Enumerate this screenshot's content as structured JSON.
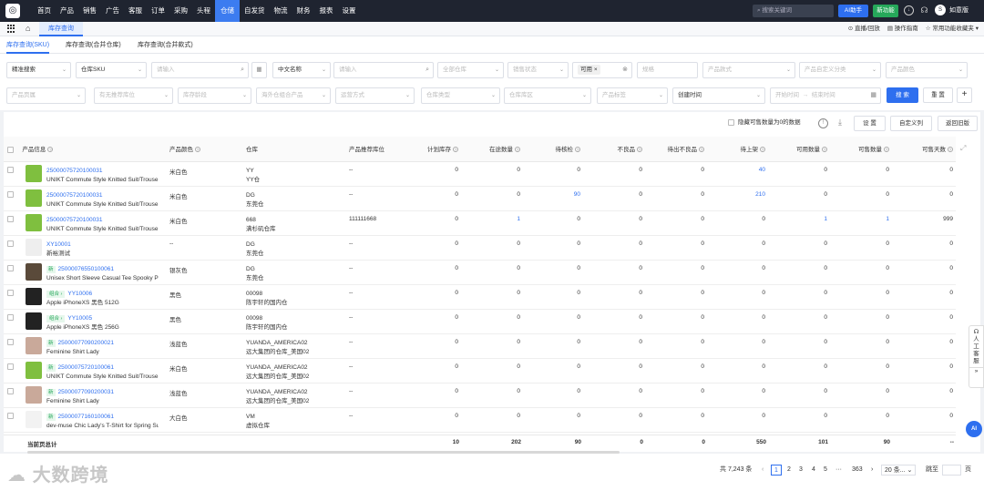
{
  "topnav": {
    "items": [
      "首页",
      "产品",
      "销售",
      "广告",
      "客服",
      "订单",
      "采购",
      "头程",
      "仓储",
      "自发货",
      "物流",
      "财务",
      "报表",
      "设置"
    ],
    "active": "仓储",
    "search_placeholder": "搜索关键词",
    "ai_label": "AI助手",
    "new_label": "新功能",
    "username": "如意版"
  },
  "tabbar": {
    "page_tab": "库存查询",
    "right_items": [
      "直播/回放",
      "操作指南",
      "常用功能收藏夹"
    ]
  },
  "subtabs": [
    "库存查询(SKU)",
    "库存查询(合并仓库)",
    "库存查询(合并款式)"
  ],
  "filters": {
    "row1": {
      "search_mode": "精准搜索",
      "sku_type": "仓库SKU",
      "input1_placeholder": "请输入",
      "name_type": "中文名称",
      "input2_placeholder": "请输入",
      "warehouse": "全部仓库",
      "sale_status": "销售状态",
      "available_tag": "可用",
      "spec": "规格",
      "product_style": "产品款式",
      "custom_category": "产品自定义分类",
      "product_color": "产品颜色"
    },
    "row2": {
      "product_attr": "产品页属",
      "replenish": "有无推荐库位",
      "inventory_age": "库存龄段",
      "overseas_platform": "海外仓组合产品",
      "shipping_method": "运营方式",
      "warehouse_type": "仓库类型",
      "warehouse_area": "仓库库区",
      "product_label": "产品标签",
      "time_type": "创建时间",
      "start_time": "开始时间",
      "end_time": "结束时间",
      "search_btn": "搜 索",
      "reset_btn": "重 置"
    }
  },
  "toolbar": {
    "hide_zero": "隐藏可售数量为0的数据",
    "settings": "设 置",
    "custom_columns": "自定义列",
    "back_old": "返回旧版"
  },
  "table": {
    "headers": [
      "产品信息",
      "产品颜色",
      "仓库",
      "产品推荐库位",
      "计划库存",
      "在途数量",
      "待核检",
      "不良品",
      "待出不良品",
      "待上架",
      "可用数量",
      "可售数量",
      "可售天数"
    ],
    "rows": [
      {
        "code": "25000075720100031",
        "name": "UNIKT Commute Style Knitted Suit/Trouse",
        "tag": "",
        "color": "米白色",
        "wh": "YY",
        "wh2": "YY仓",
        "loc": "--",
        "plan": "0",
        "transit": "0",
        "inspect": "0",
        "bad": "0",
        "badout": "0",
        "shelf": "40",
        "avail": "0",
        "sell": "0",
        "days": "0",
        "thumb": "#7fbf3f"
      },
      {
        "code": "25000075720100031",
        "name": "UNIKT Commute Style Knitted Suit/Trouse",
        "tag": "",
        "color": "米白色",
        "wh": "DG",
        "wh2": "东莞仓",
        "loc": "--",
        "plan": "0",
        "transit": "0",
        "inspect": "90",
        "bad": "0",
        "badout": "0",
        "shelf": "210",
        "avail": "0",
        "sell": "0",
        "days": "0",
        "thumb": "#7fbf3f"
      },
      {
        "code": "25000075720100031",
        "name": "UNIKT Commute Style Knitted Suit/Trouse",
        "tag": "",
        "color": "米白色",
        "wh": "668",
        "wh2": "满杉矶仓库",
        "loc": "111111668",
        "plan": "0",
        "transit": "1",
        "inspect": "0",
        "bad": "0",
        "badout": "0",
        "shelf": "0",
        "avail": "1",
        "sell": "1",
        "days": "999",
        "thumb": "#7fbf3f"
      },
      {
        "code": "XY10001",
        "name": "新裕测试",
        "tag": "",
        "color": "--",
        "wh": "DG",
        "wh2": "东莞仓",
        "loc": "--",
        "plan": "0",
        "transit": "0",
        "inspect": "0",
        "bad": "0",
        "badout": "0",
        "shelf": "0",
        "avail": "0",
        "sell": "0",
        "days": "0",
        "thumb": "#eeeeee"
      },
      {
        "code": "25000076550100061",
        "name": "Unisex Short Sleeve Casual Tee Spooky Pu",
        "tag": "新",
        "color": "银灰色",
        "wh": "DG",
        "wh2": "东莞仓",
        "loc": "--",
        "plan": "0",
        "transit": "0",
        "inspect": "0",
        "bad": "0",
        "badout": "0",
        "shelf": "0",
        "avail": "0",
        "sell": "0",
        "days": "0",
        "thumb": "#5a4a3a"
      },
      {
        "code": "YY10006",
        "name": "Apple iPhoneXS 黑色 512G",
        "tag": "组合",
        "color": "黑色",
        "wh": "00098",
        "wh2": "陈宇轩的国内仓",
        "loc": "--",
        "plan": "0",
        "transit": "0",
        "inspect": "0",
        "bad": "0",
        "badout": "0",
        "shelf": "0",
        "avail": "0",
        "sell": "0",
        "days": "0",
        "thumb": "#222222"
      },
      {
        "code": "YY10005",
        "name": "Apple iPhoneXS 黑色 256G",
        "tag": "组合",
        "color": "黑色",
        "wh": "00098",
        "wh2": "陈宇轩的国内仓",
        "loc": "--",
        "plan": "0",
        "transit": "0",
        "inspect": "0",
        "bad": "0",
        "badout": "0",
        "shelf": "0",
        "avail": "0",
        "sell": "0",
        "days": "0",
        "thumb": "#222222"
      },
      {
        "code": "25000077090200021",
        "name": "Feminine Shirt Lady",
        "tag": "新",
        "color": "浅蓝色",
        "wh": "YUANDA_AMERICA02",
        "wh2": "远大集团的仓库_美国02",
        "loc": "--",
        "plan": "0",
        "transit": "0",
        "inspect": "0",
        "bad": "0",
        "badout": "0",
        "shelf": "0",
        "avail": "0",
        "sell": "0",
        "days": "0",
        "thumb": "#c9a99a"
      },
      {
        "code": "25000075720100061",
        "name": "UNIKT Commute Style Knitted Suit/Trouse",
        "tag": "新",
        "color": "米白色",
        "wh": "YUANDA_AMERICA02",
        "wh2": "远大集团的仓库_美国02",
        "loc": "--",
        "plan": "0",
        "transit": "0",
        "inspect": "0",
        "bad": "0",
        "badout": "0",
        "shelf": "0",
        "avail": "0",
        "sell": "0",
        "days": "0",
        "thumb": "#7fbf3f"
      },
      {
        "code": "25000077090200031",
        "name": "Feminine Shirt Lady",
        "tag": "新",
        "color": "浅蓝色",
        "wh": "YUANDA_AMERICA02",
        "wh2": "远大集团的仓库_美国02",
        "loc": "--",
        "plan": "0",
        "transit": "0",
        "inspect": "0",
        "bad": "0",
        "badout": "0",
        "shelf": "0",
        "avail": "0",
        "sell": "0",
        "days": "0",
        "thumb": "#c9a99a"
      },
      {
        "code": "25000077160100061",
        "name": "dev-muse Chic Lady's T-Shirt for Spring Su",
        "tag": "新",
        "color": "大白色",
        "wh": "VM",
        "wh2": "虚拟仓库",
        "loc": "--",
        "plan": "0",
        "transit": "0",
        "inspect": "0",
        "bad": "0",
        "badout": "0",
        "shelf": "0",
        "avail": "0",
        "sell": "0",
        "days": "0",
        "thumb": "#f2f2f2"
      }
    ],
    "summary": {
      "label": "当前页总计",
      "plan": "10",
      "transit": "202",
      "inspect": "90",
      "bad": "0",
      "badout": "0",
      "shelf": "550",
      "avail": "101",
      "sell": "90",
      "days": "--"
    }
  },
  "pager": {
    "total": "共 7,243 条",
    "pages": [
      "1",
      "2",
      "3",
      "4",
      "5",
      "···",
      "363"
    ],
    "page_size": "20 条...",
    "goto": "跳至",
    "page_unit": "页"
  },
  "watermark": "大数跨境",
  "float_cs": "人工客服",
  "float_ai": "AI"
}
